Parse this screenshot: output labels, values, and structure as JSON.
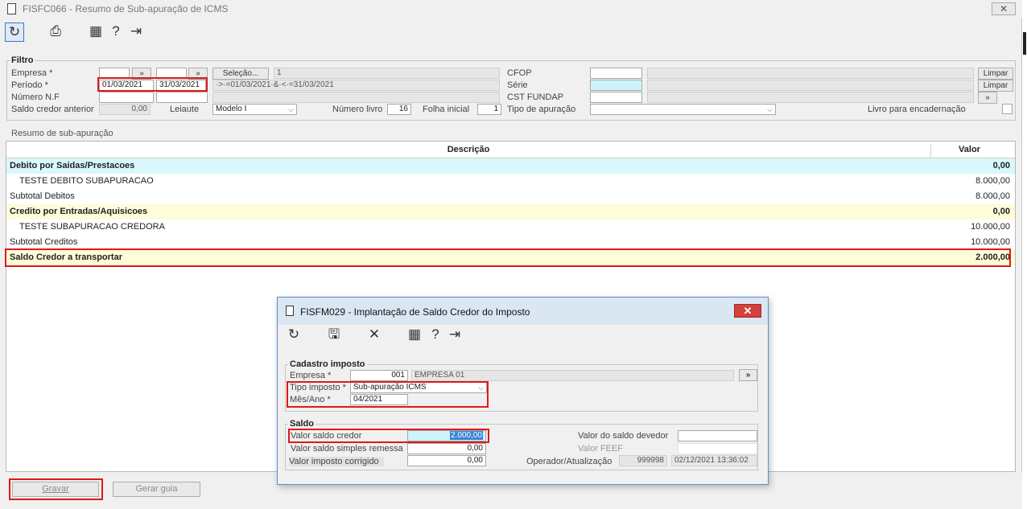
{
  "window": {
    "title": "FISFC066 - Resumo de Sub-apuração de ICMS"
  },
  "toolbar": {
    "icons": [
      "refresh-icon",
      "print-icon",
      "calendar-icon",
      "help-icon",
      "exit-icon"
    ]
  },
  "filter": {
    "legend": "Filtro",
    "empresa_label": "Empresa *",
    "periodo_label": "Período *",
    "periodo_start": "01/03/2021",
    "periodo_end": "31/03/2021",
    "numero_nf_label": "Número N.F",
    "saldo_credor_anterior_label": "Saldo credor anterior",
    "saldo_credor_anterior_value": "0,00",
    "leiaute_label": "Leiaute",
    "leiaute_value": "Modelo I",
    "numero_livro_label": "Número livro",
    "numero_livro_value": "16",
    "folha_inicial_label": "Folha inicial",
    "folha_inicial_value": "1",
    "selecao_button": "Seleção...",
    "selecao_value": "1",
    "selecao_expr": "·>·=01/03/2021·&·<·=31/03/2021",
    "cfop_label": "CFOP",
    "serie_label": "Série",
    "cst_fundap_label": "CST FUNDAP",
    "tipo_apuracao_label": "Tipo de apuração",
    "livro_encadernacao_label": "Livro para encadernação",
    "limpar_button_1": "Limpar",
    "limpar_button_2": "Limpar"
  },
  "summary": {
    "caption": "Resumo de sub-apuração",
    "columns": {
      "descricao": "Descrição",
      "valor": "Valor"
    },
    "rows": [
      {
        "descricao": "Debito por Saidas/Prestacoes",
        "valor": "0,00"
      },
      {
        "descricao": "TESTE DEBITO SUBAPURACAO",
        "valor": "8.000,00"
      },
      {
        "descricao": "Subtotal Debitos",
        "valor": "8.000,00"
      },
      {
        "descricao": "Credito por Entradas/Aquisicoes",
        "valor": "0,00"
      },
      {
        "descricao": "TESTE SUBAPURACAO CREDORA",
        "valor": "10.000,00"
      },
      {
        "descricao": "Subtotal Creditos",
        "valor": "10.000,00"
      },
      {
        "descricao": "Saldo Credor a transportar",
        "valor": "2.000,00"
      }
    ]
  },
  "bottom": {
    "gravar": "Gravar",
    "gerar_guia": "Gerar guia"
  },
  "modal": {
    "title": "FISFM029 - Implantação de Saldo Credor do Imposto",
    "cadastro_legend": "Cadastro imposto",
    "empresa_label": "Empresa *",
    "empresa_code": "001",
    "empresa_name": "EMPRESA 01",
    "lookup_button": "»",
    "tipo_imposto_label": "Tipo imposto *",
    "tipo_imposto_value": "Sub-apuração ICMS",
    "mes_ano_label": "Mês/Ano *",
    "mes_ano_value": "04/2021",
    "saldo_legend": "Saldo",
    "valor_saldo_credor_label": "Valor saldo credor",
    "valor_saldo_credor_value": "2.000,00",
    "valor_saldo_simples_label": "Valor saldo simples remessa",
    "valor_saldo_simples_value": "0,00",
    "valor_imposto_corrigido_label": "Valor imposto corrigido",
    "valor_imposto_corrigido_value": "0,00",
    "valor_saldo_devedor_label": "Valor do saldo devedor",
    "valor_feef_label": "Valor FEEF",
    "operador_label": "Operador/Atualização",
    "operador_value": "999998",
    "atualizacao_value": "02/12/2021 13:36:02"
  }
}
